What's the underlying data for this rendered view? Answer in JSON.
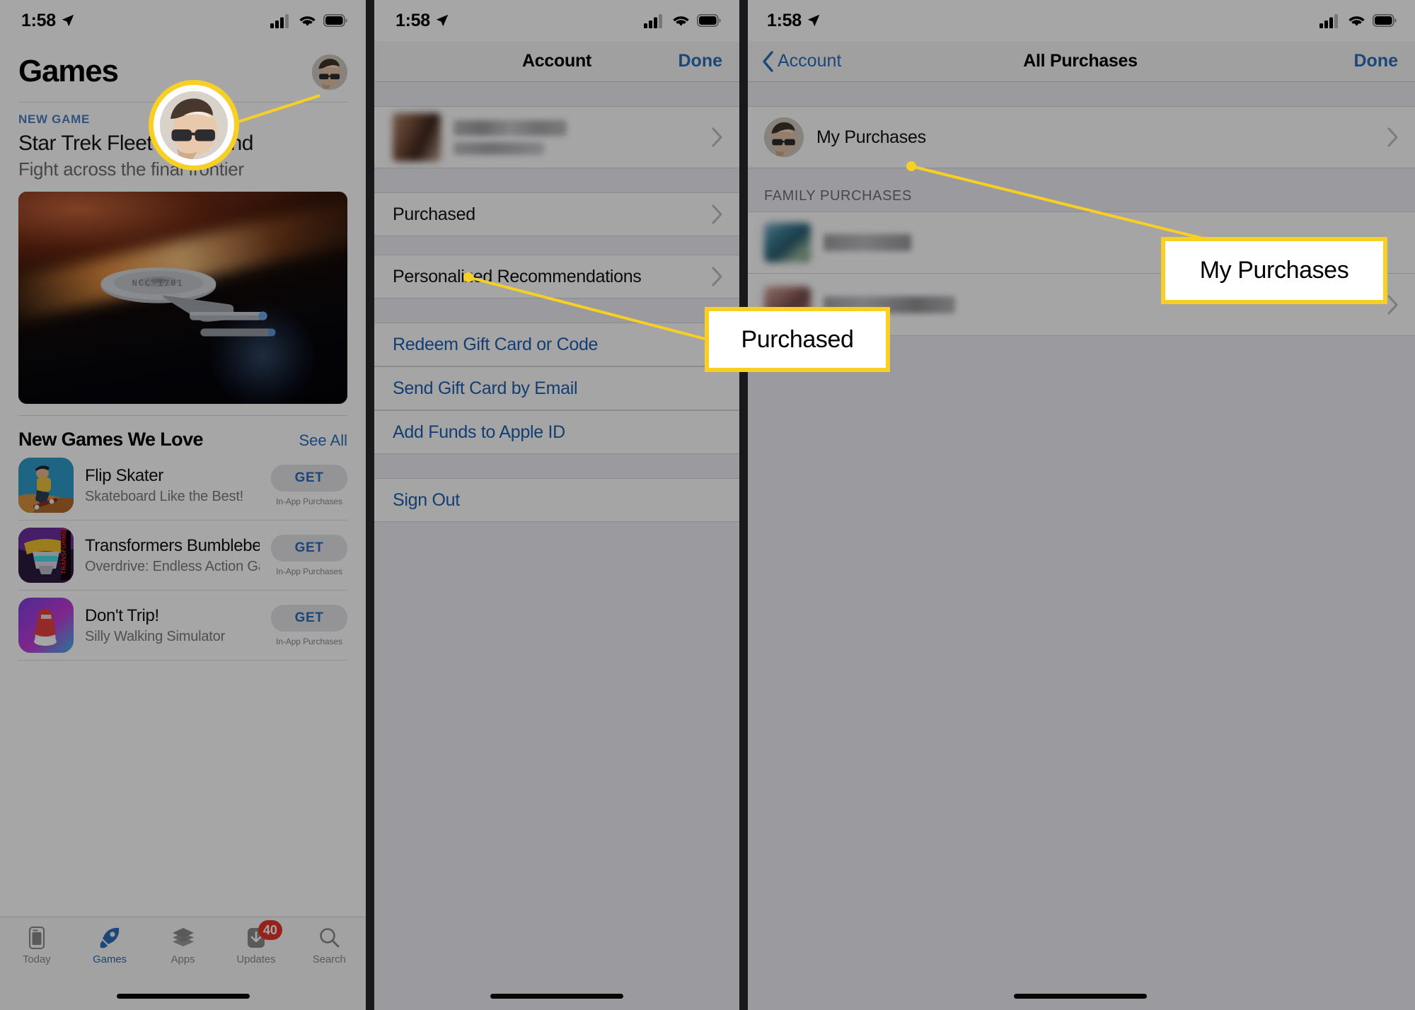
{
  "panel1": {
    "status": {
      "time": "1:58",
      "location_icon": "location-arrow-icon",
      "cellular_icon": "cellular-bars-icon",
      "wifi_icon": "wifi-icon",
      "battery_icon": "battery-icon"
    },
    "page_title": "Games",
    "avatar_icon": "account-avatar",
    "featured": {
      "kicker": "NEW GAME",
      "title": "Star Trek Fleet Command",
      "subtitle": "Fight across the final frontier",
      "hero_icon": "starship-hero-image"
    },
    "section": {
      "title": "New Games We Love",
      "see_all": "See All"
    },
    "apps": [
      {
        "name": "Flip Skater",
        "subtitle": "Skateboard Like the Best!",
        "button": "GET",
        "note": "In-App Purchases",
        "icon": "flip-skater-app-icon"
      },
      {
        "name": "Transformers Bumblebee",
        "subtitle": "Overdrive: Endless Action Game",
        "button": "GET",
        "note": "In-App Purchases",
        "icon": "transformers-app-icon"
      },
      {
        "name": "Don't Trip!",
        "subtitle": "Silly Walking Simulator",
        "button": "GET",
        "note": "In-App Purchases",
        "icon": "dont-trip-app-icon"
      }
    ],
    "tabs": [
      {
        "label": "Today",
        "icon": "today-icon",
        "active": false,
        "badge": ""
      },
      {
        "label": "Games",
        "icon": "rocket-icon",
        "active": true,
        "badge": ""
      },
      {
        "label": "Apps",
        "icon": "stack-icon",
        "active": false,
        "badge": ""
      },
      {
        "label": "Updates",
        "icon": "download-icon",
        "active": false,
        "badge": "40"
      },
      {
        "label": "Search",
        "icon": "search-icon",
        "active": false,
        "badge": ""
      }
    ]
  },
  "panel2": {
    "status": {
      "time": "1:58"
    },
    "nav": {
      "title": "Account",
      "right": "Done"
    },
    "account_row": {
      "redacted_avatar": "blurred-profile-photo",
      "redacted_name": "blurred-account-name"
    },
    "rows": [
      {
        "label": "Purchased",
        "type": "nav"
      },
      {
        "label": "Personalized Recommendations",
        "type": "nav"
      }
    ],
    "links": [
      {
        "label": "Redeem Gift Card or Code"
      },
      {
        "label": "Send Gift Card by Email"
      },
      {
        "label": "Add Funds to Apple ID"
      }
    ],
    "sign_out": "Sign Out"
  },
  "panel3": {
    "status": {
      "time": "1:58"
    },
    "nav": {
      "back": "Account",
      "title": "All Purchases",
      "right": "Done"
    },
    "my_purchases": {
      "label": "My Purchases",
      "avatar_icon": "account-avatar"
    },
    "family_header": "FAMILY PURCHASES",
    "family_rows": [
      {
        "redacted_icon": "blurred-family-avatar-1",
        "redacted_name": "blurred-family-name-1"
      },
      {
        "redacted_icon": "blurred-family-avatar-2",
        "redacted_name": "blurred-family-name-2"
      }
    ]
  },
  "annotations": {
    "highlight_color": "#f8cf23",
    "callouts": [
      {
        "id": "purchased",
        "text": "Purchased"
      },
      {
        "id": "my-purchases",
        "text": "My Purchases"
      }
    ],
    "spotlight": {
      "id": "avatar-spotlight",
      "target": "account-avatar"
    }
  }
}
